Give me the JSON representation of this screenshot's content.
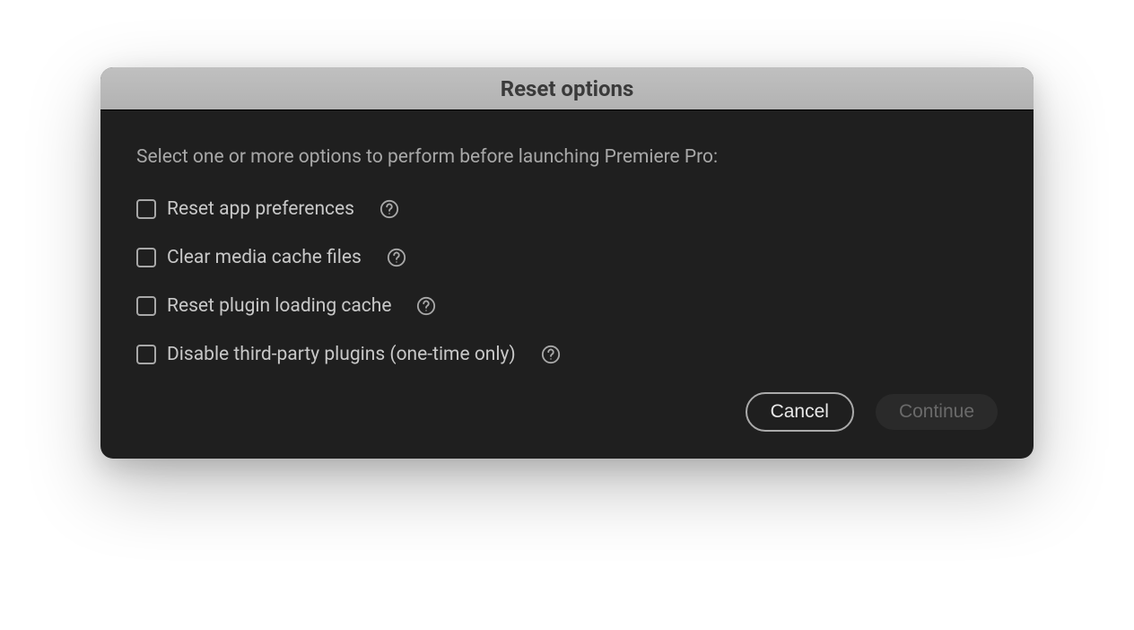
{
  "dialog": {
    "title": "Reset options",
    "instruction": "Select one or more options to perform before launching Premiere Pro:",
    "options": [
      {
        "label": "Reset app preferences"
      },
      {
        "label": "Clear media cache files"
      },
      {
        "label": "Reset plugin loading cache"
      },
      {
        "label": "Disable third-party plugins (one-time only)"
      }
    ],
    "buttons": {
      "cancel": "Cancel",
      "continue": "Continue"
    }
  }
}
